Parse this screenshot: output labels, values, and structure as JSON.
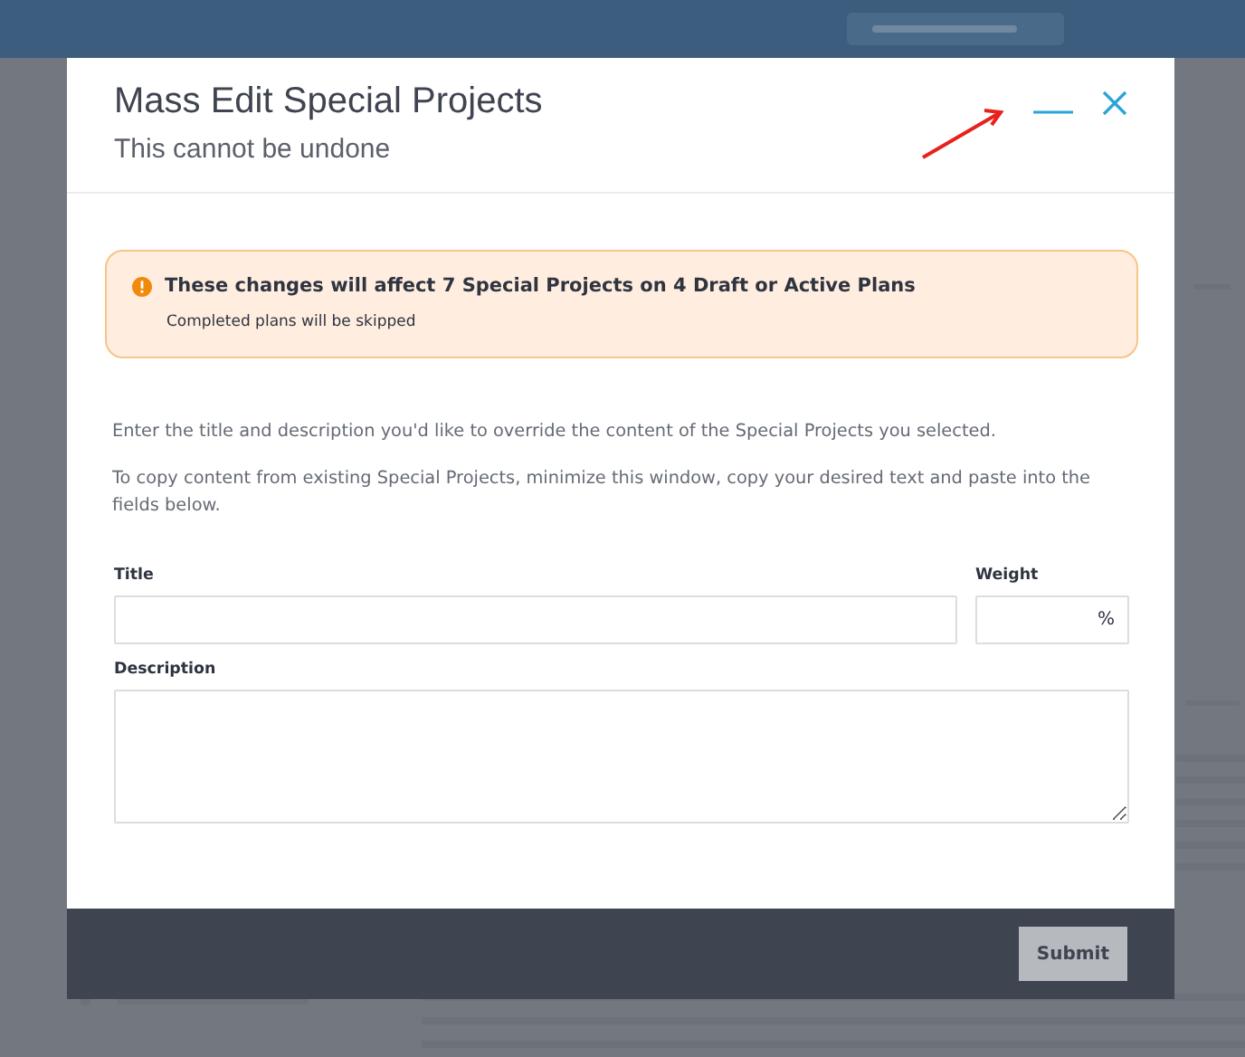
{
  "dialog": {
    "title": "Mass Edit Special Projects",
    "subtitle": "This cannot be undone",
    "alert": {
      "kind": "warning",
      "heading": "These changes will affect 7 Special Projects on 4 Draft or Active Plans",
      "detail": "Completed plans will be skipped"
    },
    "paragraphs": [
      "Enter the title and description you'd like to override the content of the Special Projects you selected.",
      "To copy content from existing Special Projects, minimize this window, copy your desired text and paste into the fields below."
    ],
    "fields": [
      {
        "kind": "text",
        "label": "Title"
      },
      {
        "kind": "percent",
        "label": "Weight",
        "suffix": "%"
      },
      {
        "kind": "textarea",
        "label": "Description"
      }
    ],
    "submit": {
      "label": "Submit",
      "disabled": true
    }
  }
}
